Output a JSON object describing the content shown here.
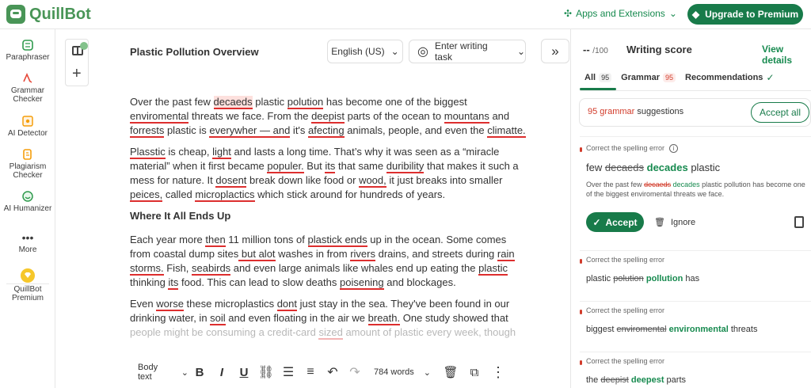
{
  "app": {
    "logo_text": "QuillBot",
    "apps_label": "Apps and Extensions",
    "premium_label": "Upgrade to Premium",
    "brand_color": "#499557",
    "accent_color": "#187b4a",
    "error_color": "#dd2e2e"
  },
  "sidebar": {
    "items": [
      {
        "label": "Paraphraser",
        "icon": "paraphraser-icon"
      },
      {
        "label": "Grammar Checker",
        "icon": "grammar-checker-icon"
      },
      {
        "label": "AI Detector",
        "icon": "ai-detector-icon"
      },
      {
        "label": "Plagiarism Checker",
        "icon": "plagiarism-checker-icon"
      },
      {
        "label": "AI Humanizer",
        "icon": "ai-humanizer-icon"
      },
      {
        "label": "More",
        "icon": "more-icon"
      },
      {
        "label": "QuillBot Premium",
        "icon": "premium-icon"
      }
    ]
  },
  "editor": {
    "doc_title": "Plastic Pollution Overview",
    "language": "English (US)",
    "task_placeholder": "Enter writing task",
    "heading": "Where It All Ends Up",
    "paragraphs": {
      "p1": [
        {
          "t": "Over the past few "
        },
        {
          "t": "decaeds",
          "e": true,
          "hi": true
        },
        {
          "t": " plastic "
        },
        {
          "t": "polution",
          "e": true
        },
        {
          "t": " has become one of the biggest "
        },
        {
          "t": "enviromental",
          "e": true
        },
        {
          "t": " threats we face. From the "
        },
        {
          "t": "deepist",
          "e": true
        },
        {
          "t": " parts of the ocean to "
        },
        {
          "t": "mountans",
          "e": true
        },
        {
          "t": " and "
        },
        {
          "t": "forrests",
          "e": true
        },
        {
          "t": " plastic is "
        },
        {
          "t": "everywher — and",
          "e": true
        },
        {
          "t": " it's "
        },
        {
          "t": "afecting",
          "e": true
        },
        {
          "t": " animals, people, and even the "
        },
        {
          "t": "climatte.",
          "e": true
        }
      ],
      "p2": [
        {
          "t": "Plasstic",
          "e": true
        },
        {
          "t": " is cheap, "
        },
        {
          "t": "light",
          "e": true
        },
        {
          "t": " and lasts a long time. That’s why it was seen as a “miracle material” when it first became "
        },
        {
          "t": "populer.",
          "e": true
        },
        {
          "t": " But "
        },
        {
          "t": "its",
          "e": true
        },
        {
          "t": " that same "
        },
        {
          "t": "duribility",
          "e": true
        },
        {
          "t": " that makes it such a mess for nature. It "
        },
        {
          "t": "dosent",
          "e": true
        },
        {
          "t": " break down like food or "
        },
        {
          "t": "wood,",
          "e": true
        },
        {
          "t": " it just breaks into smaller "
        },
        {
          "t": "peices,",
          "e": true
        },
        {
          "t": " called "
        },
        {
          "t": "microplactics",
          "e": true
        },
        {
          "t": " which stick around for hundreds of years."
        }
      ],
      "p3": [
        {
          "t": "Each year more "
        },
        {
          "t": "then",
          "e": true
        },
        {
          "t": " 11 million tons of "
        },
        {
          "t": "plastick ends",
          "e": true
        },
        {
          "t": " up in the ocean. Some comes from coastal dump sites"
        },
        {
          "t": " but alot",
          "e": true
        },
        {
          "t": " washes in from "
        },
        {
          "t": "rivers",
          "e": true
        },
        {
          "t": " drains, and streets during "
        },
        {
          "t": "rain storms.",
          "e": true
        },
        {
          "t": " Fish, "
        },
        {
          "t": "seabirds",
          "e": true
        },
        {
          "t": " and even large animals like whales end up eating the "
        },
        {
          "t": "plastic",
          "e": true
        },
        {
          "t": " thinking "
        },
        {
          "t": "its",
          "e": true
        },
        {
          "t": " food. This can lead to slow deaths "
        },
        {
          "t": "poisening",
          "e": true
        },
        {
          "t": " and blockages."
        }
      ],
      "p4": [
        {
          "t": "Even "
        },
        {
          "t": "worse",
          "e": true
        },
        {
          "t": " these microplastics "
        },
        {
          "t": "dont",
          "e": true
        },
        {
          "t": " just stay in the sea. They've been found in our drinking water, in "
        },
        {
          "t": "soil",
          "e": true
        },
        {
          "t": " and even floating in the air we "
        },
        {
          "t": "breath.",
          "e": true
        },
        {
          "t": " One study showed that "
        },
        {
          "t": "people might be consuming a credit-card ",
          "f": true
        },
        {
          "t": "sized",
          "e": true,
          "f": true
        },
        {
          "t": " amount of plastic every week, though",
          "f": true
        }
      ]
    },
    "bottom": {
      "style": "Body text",
      "words": "784 words"
    }
  },
  "panel": {
    "score_value": "--",
    "score_suffix": "/100",
    "title": "Writing score",
    "details": "View details",
    "tabs": [
      {
        "label": "All",
        "badge": "95"
      },
      {
        "label": "Grammar",
        "badge": "95"
      },
      {
        "label": "Recommendations",
        "badge": ""
      }
    ],
    "suggestion_count": "95 grammar",
    "suggestion_suffix": "suggestions",
    "accept_all": "Accept all",
    "cards": [
      {
        "label": "Correct the spelling error",
        "before": "few",
        "wrong": "decaeds",
        "right": "decades",
        "after": "plastic",
        "context_before": "Over the past few",
        "context_wrong": "decaeds",
        "context_right": "decades",
        "context_after": "plastic pollution has become one of the biggest enviromental threats we face.",
        "accept": "Accept",
        "ignore": "Ignore"
      },
      {
        "label": "Correct the spelling error",
        "before": "plastic",
        "wrong": "polution",
        "right": "pollution",
        "after": "has"
      },
      {
        "label": "Correct the spelling error",
        "before": "biggest",
        "wrong": "enviromental",
        "right": "environmental",
        "after": "threats"
      },
      {
        "label": "Correct the spelling error",
        "before": "the",
        "wrong": "deepist",
        "right": "deepest",
        "after": "parts"
      }
    ]
  }
}
